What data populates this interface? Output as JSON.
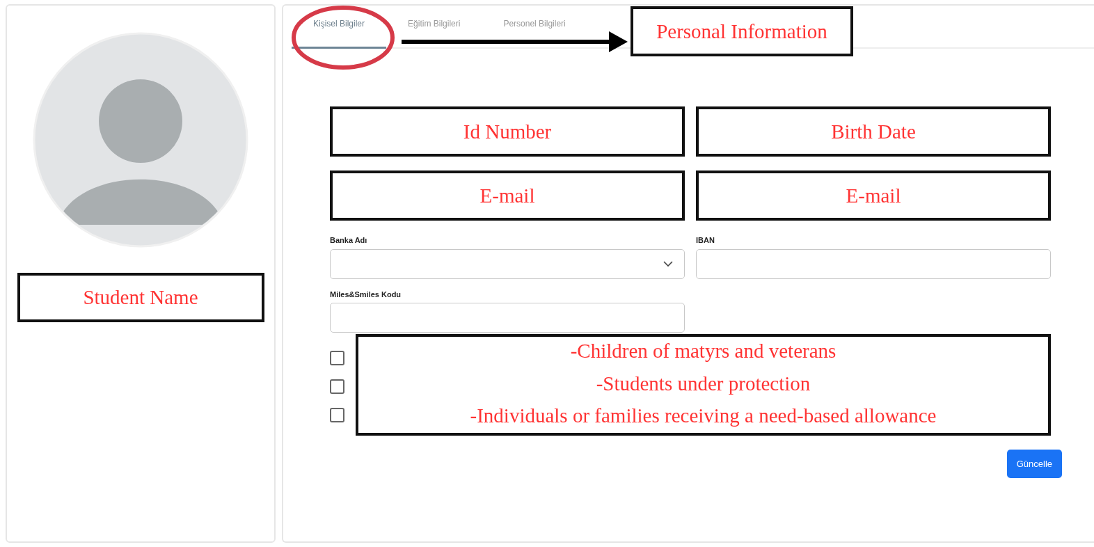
{
  "tabs": [
    {
      "label": "Kişisel Bilgiler",
      "selected": true
    },
    {
      "label": "Eğitim Bilgileri",
      "selected": false
    },
    {
      "label": "Personel Bilgileri",
      "selected": false
    }
  ],
  "annotations": {
    "tab_note": "Personal Information",
    "name_note": "Student Name",
    "field_notes": [
      "Id Number",
      "Birth Date",
      "E-mail",
      "E-mail"
    ],
    "checkbox_notes": [
      "-Children of matyrs and veterans",
      "-Students under protection",
      "-Individuals or families receiving a need-based allowance"
    ]
  },
  "fields": [
    {
      "label": "Banka Adı",
      "kind": "select"
    },
    {
      "label": "IBAN",
      "kind": "text"
    },
    {
      "label": "Miles&Smiles Kodu",
      "kind": "text"
    }
  ],
  "checkboxes": [
    {
      "checked": false
    },
    {
      "checked": false
    },
    {
      "checked": false
    }
  ],
  "button": "Güncelle"
}
